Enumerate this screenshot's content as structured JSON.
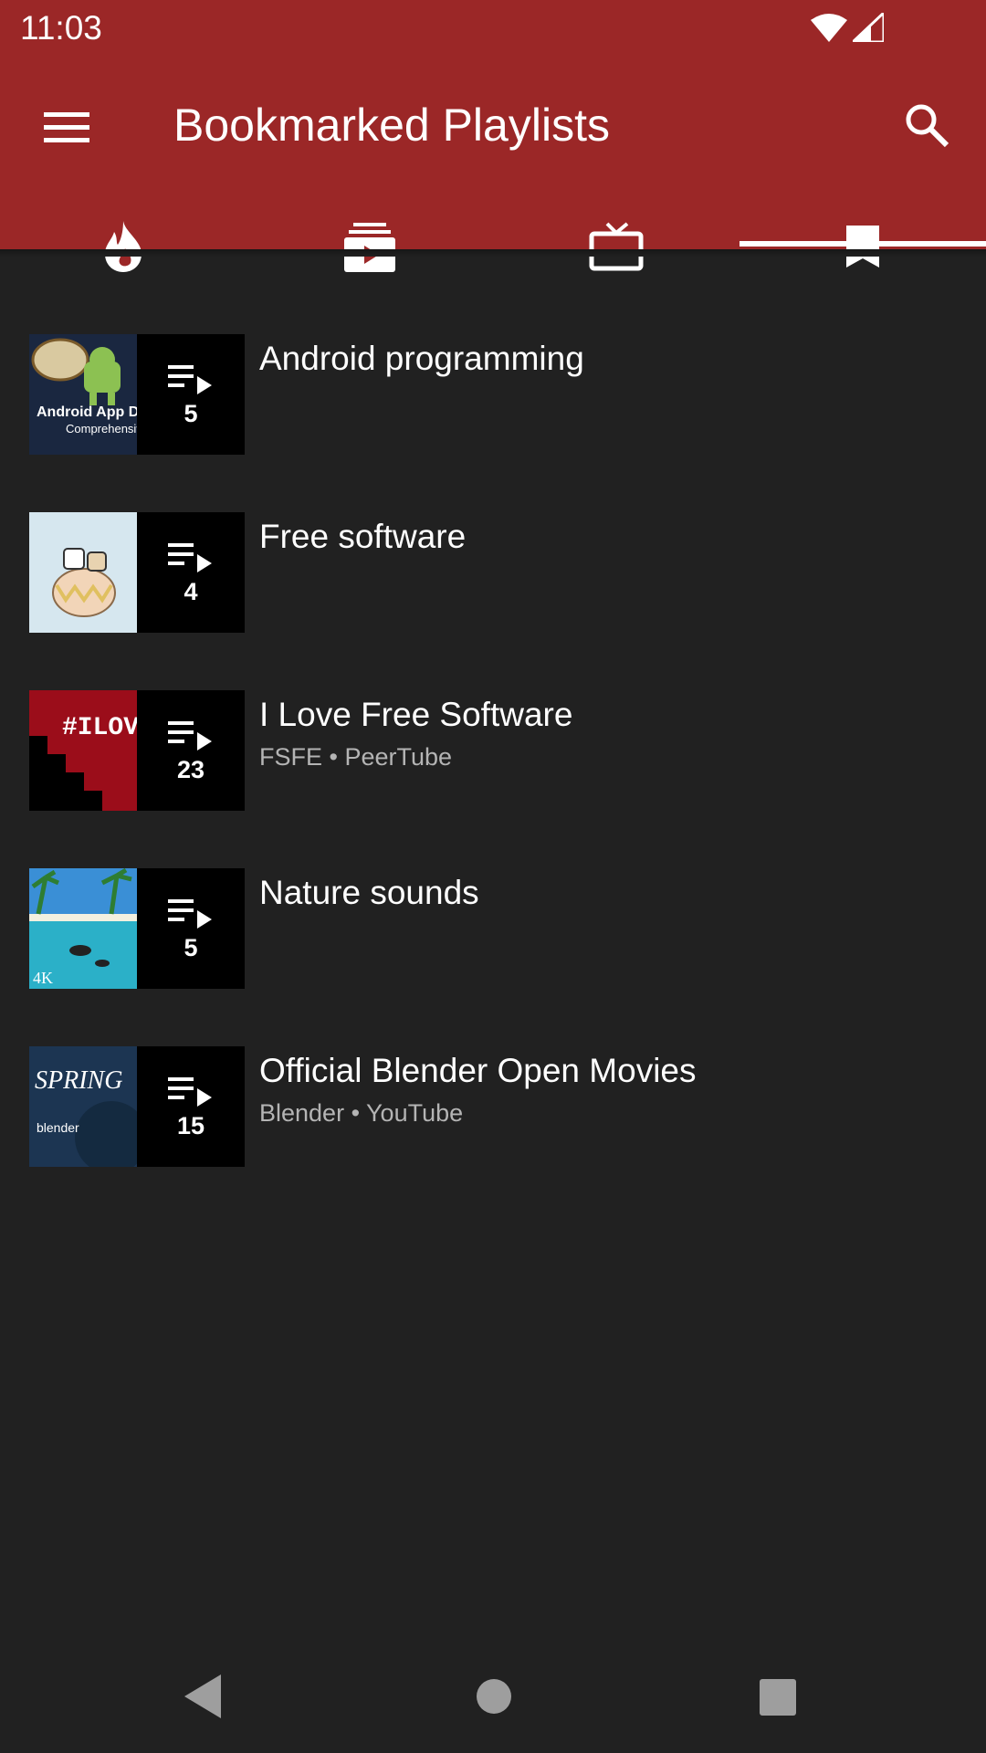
{
  "status_bar": {
    "time": "11:03"
  },
  "app_bar": {
    "title": "Bookmarked Playlists"
  },
  "tabs": [
    {
      "icon": "fire-icon",
      "selected": false
    },
    {
      "icon": "subscriptions-icon",
      "selected": false
    },
    {
      "icon": "tv-icon",
      "selected": false
    },
    {
      "icon": "bookmark-icon",
      "selected": true
    }
  ],
  "playlists": [
    {
      "title": "Android programming",
      "subtitle": "",
      "count": "5",
      "thumb_lines": [
        "Android App Development",
        "Comprehensive Course"
      ]
    },
    {
      "title": "Free software",
      "subtitle": "",
      "count": "4"
    },
    {
      "title": "I Love Free Software",
      "subtitle": "FSFE • PeerTube",
      "count": "23",
      "thumb_lines": [
        "#ILOVEFS"
      ]
    },
    {
      "title": "Nature sounds",
      "subtitle": "",
      "count": "5",
      "thumb_lines": [
        "4K"
      ]
    },
    {
      "title": "Official Blender Open Movies",
      "subtitle": "Blender • YouTube",
      "count": "15",
      "thumb_lines": [
        "SPRING",
        "blender"
      ]
    }
  ],
  "colors": {
    "app_bar": "#9b2727",
    "background": "#212121",
    "subtitle": "#b4b4b4"
  }
}
